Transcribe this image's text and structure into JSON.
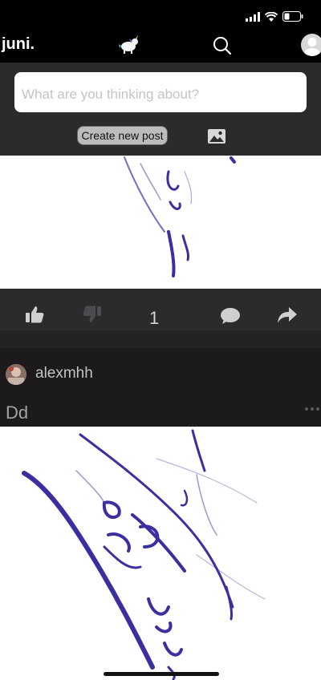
{
  "header": {
    "app_title": "juni."
  },
  "composer": {
    "placeholder": "What are you thinking about?",
    "create_post_label": "Create new post"
  },
  "posts": [
    {
      "like_count": "1"
    },
    {
      "author": "alexmhh",
      "text": "Dd"
    }
  ],
  "icons": {
    "status": [
      "signal-icon",
      "wifi-icon",
      "battery-icon"
    ],
    "nav": [
      "mascot-icon",
      "search-icon",
      "profile-icon"
    ],
    "composer": [
      "image-upload-icon"
    ],
    "actions": [
      "thumbs-up-icon",
      "thumbs-down-icon",
      "comment-icon",
      "share-icon"
    ],
    "post_menu": "more-icon"
  },
  "colors": {
    "background": "#1c1a1d",
    "panel": "#2b2a2d",
    "ink": "#3b2fa0"
  }
}
